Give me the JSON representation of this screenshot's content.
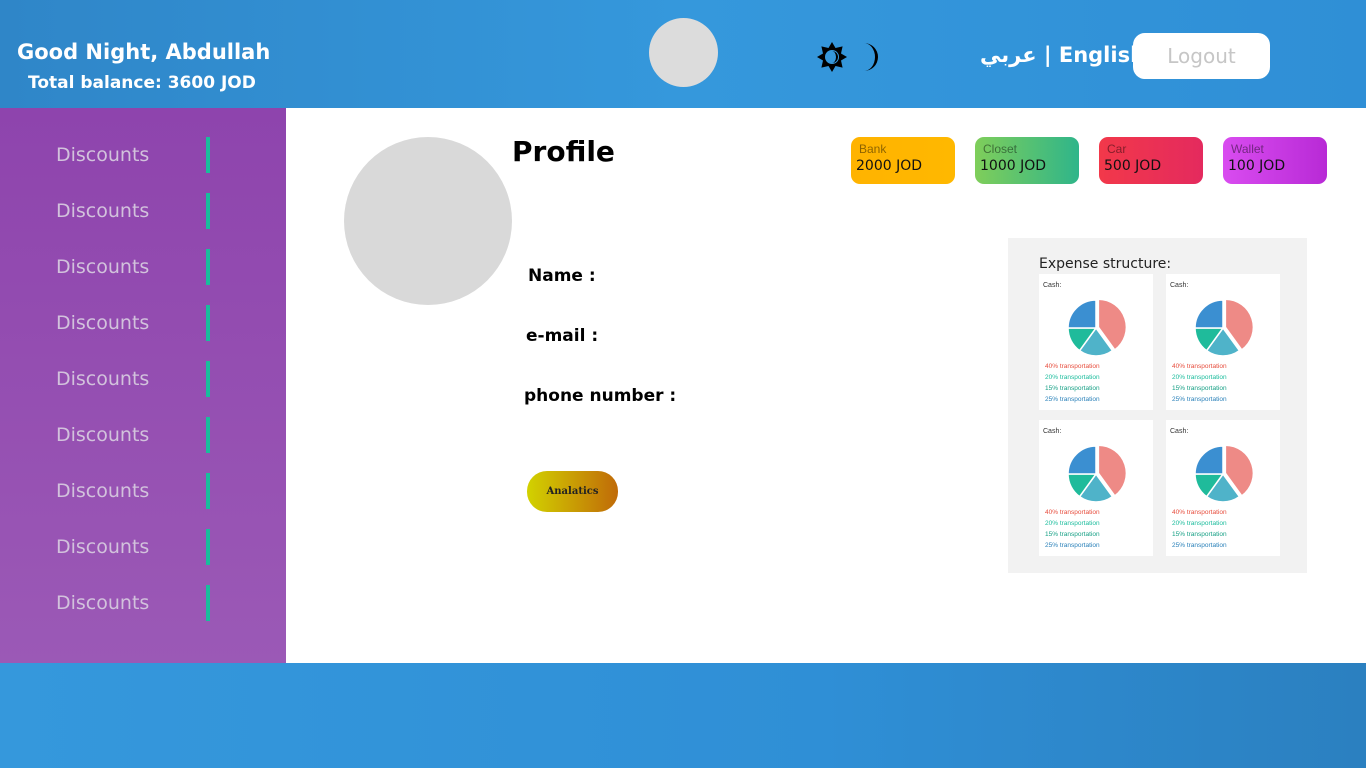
{
  "header": {
    "greeting": "Good Night, Abdullah",
    "balance": "Total balance: 3600 JOD",
    "lang_ar": "عربي",
    "lang_sep": " | ",
    "lang_en": "English",
    "logout_label": "Logout"
  },
  "sidebar": {
    "items": [
      {
        "label": "Discounts"
      },
      {
        "label": "Discounts"
      },
      {
        "label": "Discounts"
      },
      {
        "label": "Discounts"
      },
      {
        "label": "Discounts"
      },
      {
        "label": "Discounts"
      },
      {
        "label": "Discounts"
      },
      {
        "label": "Discounts"
      },
      {
        "label": "Discounts"
      }
    ]
  },
  "profile": {
    "title": "Profile",
    "name_label": "Name :",
    "email_label": "e-mail :",
    "phone_label": "phone number :",
    "analytics_label": "Analatics"
  },
  "accounts": [
    {
      "title": "Bank",
      "amount": "2000 JOD",
      "color": "#ffb300"
    },
    {
      "title": "Closet",
      "amount": "1000 JOD",
      "color": "#4cc07a"
    },
    {
      "title": "Car",
      "amount": "500 JOD",
      "color": "#ee2e57"
    },
    {
      "title": "Wallet",
      "amount": "100 JOD",
      "color": "#c832e0"
    }
  ],
  "expense": {
    "title": "Expense structure:",
    "cards": [
      {
        "title": "Cash:"
      },
      {
        "title": "Cash:"
      },
      {
        "title": "Cash:"
      },
      {
        "title": "Cash:"
      }
    ],
    "legend": [
      {
        "text": "40% transportation",
        "color": "#e74c3c",
        "value": 40
      },
      {
        "text": "20% transportation",
        "color": "#1abc9c",
        "value": 20
      },
      {
        "text": "15% transportation",
        "color": "#16a085",
        "value": 15
      },
      {
        "text": "25% transportation",
        "color": "#2980b9",
        "value": 25
      }
    ],
    "slice_colors": [
      "#ee8a86",
      "#4fb3c9",
      "#1fbb9b",
      "#3b8fd1"
    ]
  },
  "colors": {
    "header": "#3598dc",
    "sidebar": "#9b59b6",
    "sidebar_accent": "#1abc9c"
  }
}
